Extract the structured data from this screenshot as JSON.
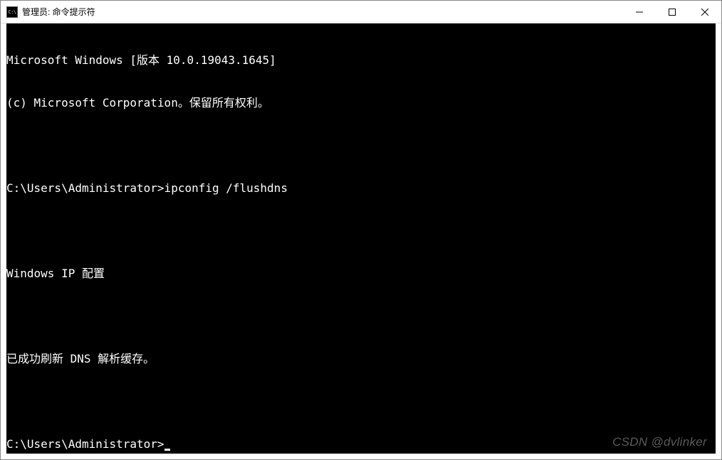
{
  "titlebar": {
    "icon_label": "C:\\",
    "title": "管理员: 命令提示符"
  },
  "terminal": {
    "lines": [
      "Microsoft Windows [版本 10.0.19043.1645]",
      "(c) Microsoft Corporation。保留所有权利。",
      "",
      "C:\\Users\\Administrator>ipconfig /flushdns",
      "",
      "Windows IP 配置",
      "",
      "已成功刷新 DNS 解析缓存。",
      "",
      "C:\\Users\\Administrator>"
    ]
  },
  "watermark": "CSDN @dvlinker"
}
